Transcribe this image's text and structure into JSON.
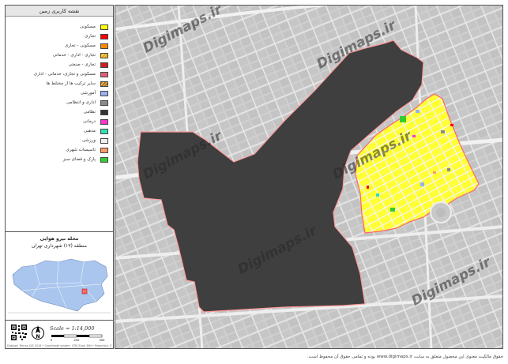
{
  "legend": {
    "title": "نقشه کاربری زمین",
    "items": [
      {
        "label": "مسکونی",
        "color": "#ffff00"
      },
      {
        "label": "تجاری",
        "color": "#ff0000"
      },
      {
        "label": "مسکونی - تجاری",
        "color": "#ff8c00"
      },
      {
        "label": "تجاری - اداری - خدماتی",
        "color": "#e8a21a"
      },
      {
        "label": "تجاری - صنعتی",
        "color": "#cc1f1f"
      },
      {
        "label": "مسکونی و تجاری، خدماتی - اداری",
        "color": "#e0607a"
      },
      {
        "label": "سایر ترکیب ها از مختلط ها",
        "color": "#b5651d"
      },
      {
        "label": "آموزشی",
        "color": "#9ab0f0"
      },
      {
        "label": "اداری و انتظامی",
        "color": "#8a8a8a"
      },
      {
        "label": "نظامی",
        "color": "#333333"
      },
      {
        "label": "درمانی",
        "color": "#ff33cc"
      },
      {
        "label": "مذهبی",
        "color": "#33e0b0"
      },
      {
        "label": "ورزشی",
        "color": "#f0f0f0"
      },
      {
        "label": "تاسیسات شهری",
        "color": "#ff9966"
      },
      {
        "label": "پارک و فضای سبز",
        "color": "#33cc33"
      }
    ]
  },
  "locator": {
    "area_name": "محله نیرو هوایی",
    "district": "منطقه (۱۳) شهرداری تهران"
  },
  "scale": {
    "text": "Scale = 1:14,000",
    "ticks": [
      "0",
      "250",
      "500"
    ]
  },
  "bottom_note": "Dataset: Tehran GIS 2018 • Coordinate system: UTM Zone 39N • Projection: Transverse Mercator",
  "watermark": "Digimaps.ir",
  "footer": "حقوق مالکیت معنوی این محصول متعلق به سایت www.digimaps.ir بوده و تمامی حقوق آن محفوظ است."
}
